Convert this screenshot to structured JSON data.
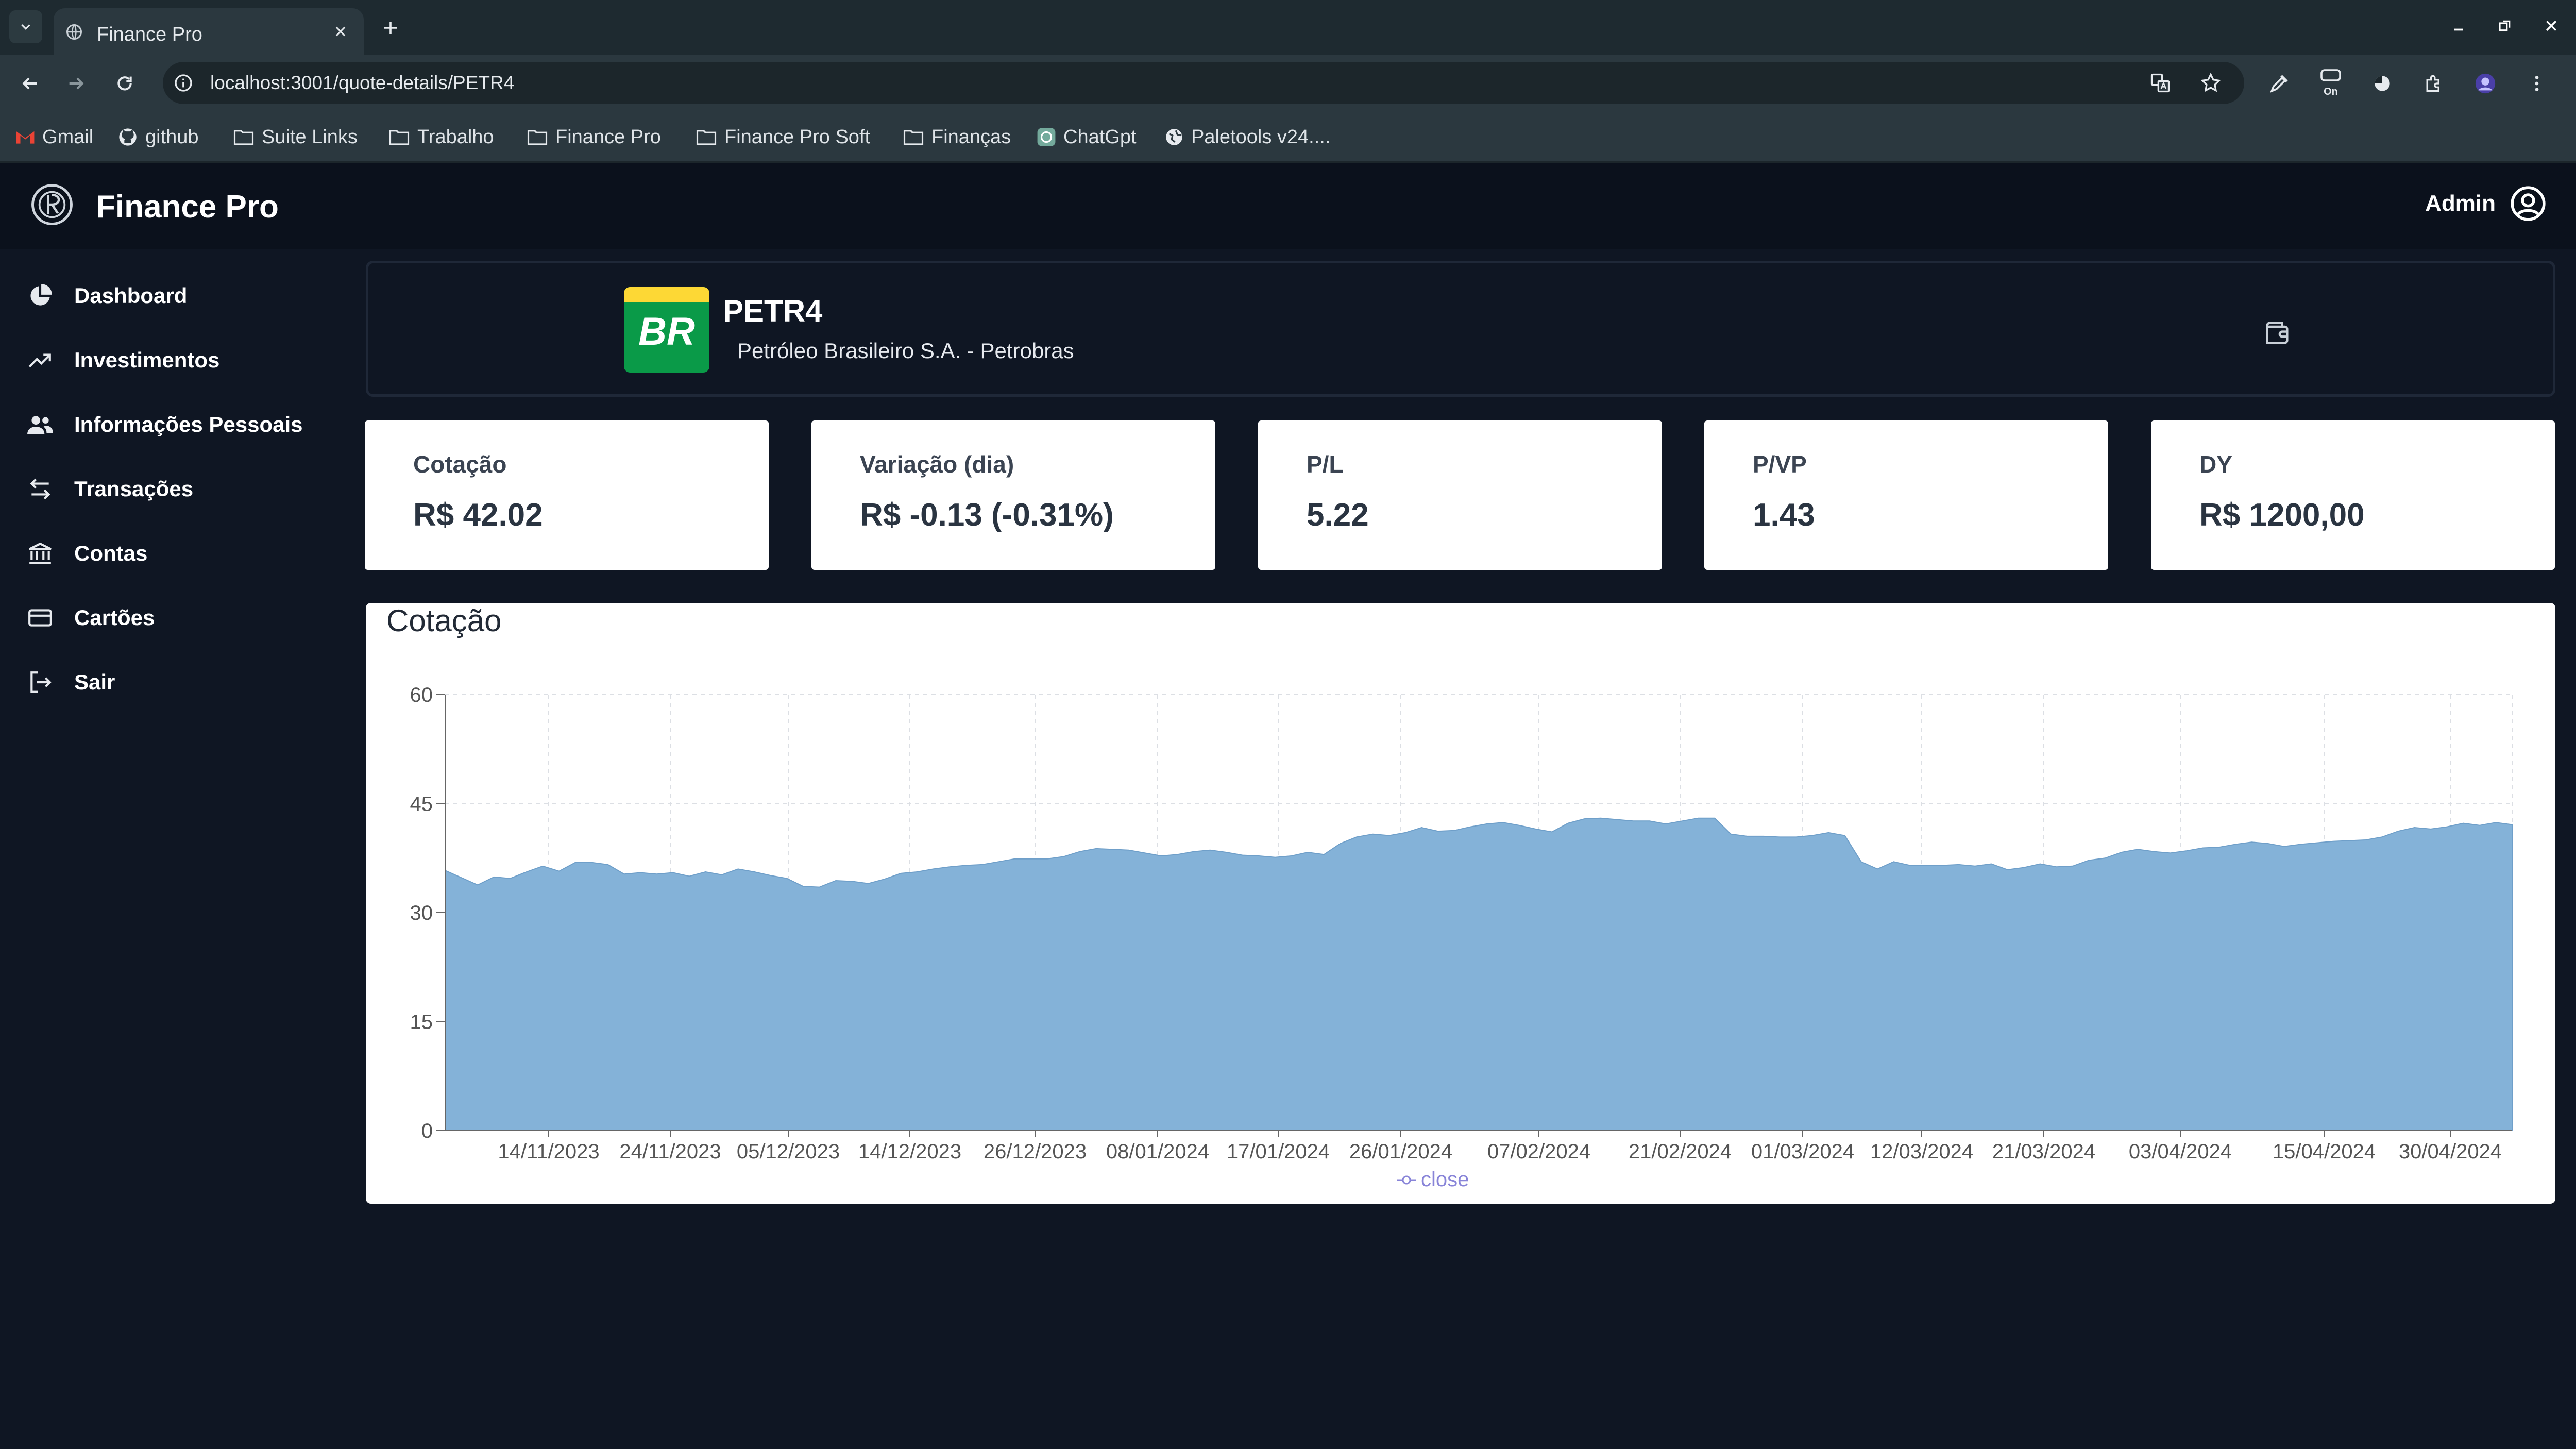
{
  "browser": {
    "tab_title": "Finance Pro",
    "url": "localhost:3001/quote-details/PETR4",
    "bookmarks": [
      {
        "label": "Gmail",
        "icon": "gmail-icon"
      },
      {
        "label": "github",
        "icon": "github-icon"
      },
      {
        "label": "Suite Links",
        "icon": "folder-icon"
      },
      {
        "label": "Trabalho",
        "icon": "folder-icon"
      },
      {
        "label": "Finance Pro",
        "icon": "folder-icon"
      },
      {
        "label": "Finance Pro Soft",
        "icon": "folder-icon"
      },
      {
        "label": "Finanças",
        "icon": "folder-icon"
      },
      {
        "label": "ChatGpt",
        "icon": "chatgpt-icon"
      },
      {
        "label": "Paletools v24....",
        "icon": "globe-icon"
      }
    ]
  },
  "app": {
    "brand": "Finance Pro",
    "user": "Admin"
  },
  "sidebar": {
    "items": [
      {
        "label": "Dashboard",
        "icon": "pie-chart-icon"
      },
      {
        "label": "Investimentos",
        "icon": "trend-up-icon"
      },
      {
        "label": "Informações Pessoais",
        "icon": "users-icon"
      },
      {
        "label": "Transações",
        "icon": "transfer-arrows-icon"
      },
      {
        "label": "Contas",
        "icon": "bank-icon"
      },
      {
        "label": "Cartões",
        "icon": "credit-card-icon"
      },
      {
        "label": "Sair",
        "icon": "logout-icon"
      }
    ]
  },
  "stock": {
    "ticker": "PETR4",
    "company": "Petróleo Brasileiro S.A. - Petrobras",
    "logo_text": "BR"
  },
  "metrics": [
    {
      "label": "Cotação",
      "value": "R$ 42.02"
    },
    {
      "label": "Variação (dia)",
      "value": "R$ -0.13 (-0.31%)"
    },
    {
      "label": "P/L",
      "value": "5.22"
    },
    {
      "label": "P/VP",
      "value": "1.43"
    },
    {
      "label": "DY",
      "value": "R$ 1200,00"
    }
  ],
  "chart_data": {
    "type": "area",
    "title": "Cotação",
    "x_ticks": [
      "14/11/2023",
      "24/11/2023",
      "05/12/2023",
      "14/12/2023",
      "26/12/2023",
      "08/01/2024",
      "17/01/2024",
      "26/01/2024",
      "07/02/2024",
      "21/02/2024",
      "01/03/2024",
      "12/03/2024",
      "21/03/2024",
      "03/04/2024",
      "15/04/2024",
      "30/04/2024"
    ],
    "y_ticks": [
      0,
      15,
      30,
      45,
      60
    ],
    "ylim": [
      0,
      60
    ],
    "grid": true,
    "legend": "bottom-center",
    "series": [
      {
        "name": "close",
        "color": "#84b2d8",
        "values": [
          35.8,
          34.8,
          33.8,
          34.9,
          34.7,
          35.6,
          36.4,
          35.7,
          36.9,
          36.9,
          36.6,
          35.3,
          35.5,
          35.3,
          35.5,
          35.0,
          35.6,
          35.2,
          36.0,
          35.6,
          35.1,
          34.7,
          33.6,
          33.5,
          34.4,
          34.3,
          34.0,
          34.6,
          35.4,
          35.6,
          36.0,
          36.3,
          36.5,
          36.6,
          37.0,
          37.4,
          37.4,
          37.4,
          37.7,
          38.4,
          38.8,
          38.7,
          38.6,
          38.2,
          37.8,
          38.0,
          38.4,
          38.6,
          38.3,
          37.9,
          37.8,
          37.6,
          37.8,
          38.3,
          38.0,
          39.5,
          40.4,
          40.8,
          40.6,
          41.0,
          41.7,
          41.2,
          41.3,
          41.8,
          42.2,
          42.4,
          42.0,
          41.5,
          41.1,
          42.3,
          42.9,
          43.0,
          42.8,
          42.6,
          42.6,
          42.2,
          42.6,
          43.0,
          43.0,
          40.8,
          40.5,
          40.5,
          40.4,
          40.4,
          40.6,
          41.0,
          40.6,
          37.0,
          36.0,
          37.0,
          36.5,
          36.5,
          36.5,
          36.6,
          36.4,
          36.7,
          35.9,
          36.2,
          36.7,
          36.3,
          36.4,
          37.2,
          37.5,
          38.3,
          38.7,
          38.4,
          38.2,
          38.5,
          38.9,
          39.0,
          39.4,
          39.7,
          39.5,
          39.1,
          39.4,
          39.6,
          39.8,
          39.9,
          40.0,
          40.4,
          41.2,
          41.7,
          41.5,
          41.8,
          42.3,
          42.0,
          42.4,
          42.1
        ]
      }
    ]
  }
}
